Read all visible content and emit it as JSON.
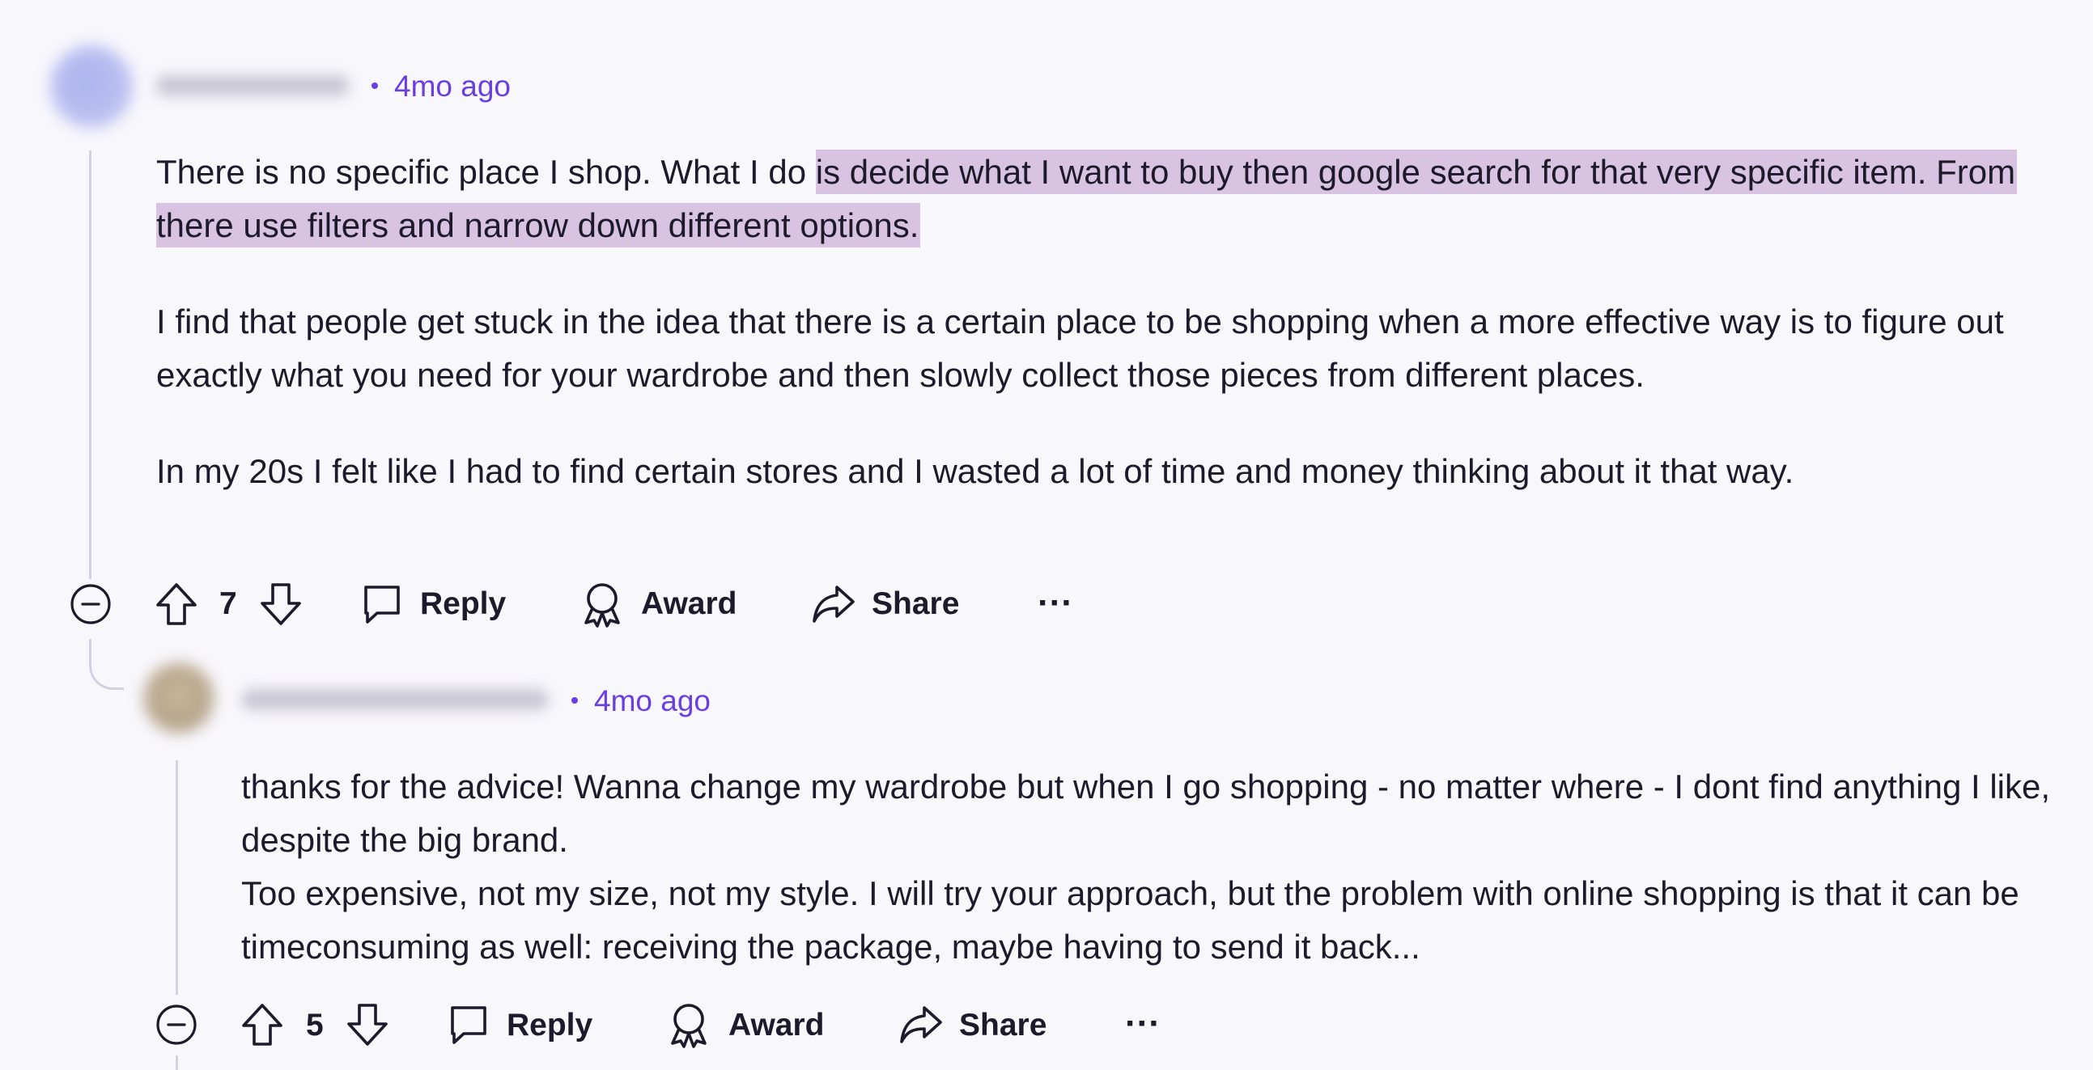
{
  "comments": [
    {
      "time": "4mo ago",
      "body_lines": {
        "p1_plain": "There is no specific place I shop. What I do ",
        "p1_highlight": "is decide what I want to buy then google search for that very specific item. From there use filters and narrow down different options.",
        "p2": "I find that people get stuck in the idea that there is a certain place to be shopping when a more effective way is to figure out exactly what you need for your wardrobe and then slowly collect those pieces from different places.",
        "p3": "In my 20s I felt like I had to find certain stores and I wasted a lot of time and money thinking about it that way."
      },
      "actions": {
        "votes": "7",
        "reply": "Reply",
        "award": "Award",
        "share": "Share",
        "more": "···"
      }
    },
    {
      "time": "4mo ago",
      "body_lines": {
        "p1": "thanks for the advice! Wanna change my wardrobe but when I go shopping - no matter where - I dont find anything I like, despite the big brand.",
        "p2": "Too expensive, not my size, not my style. I will try your approach, but the problem with online shopping is that it can be timeconsuming as well: receiving the package, maybe having to send it back..."
      },
      "actions": {
        "votes": "5",
        "reply": "Reply",
        "award": "Award",
        "share": "Share",
        "more": "···"
      }
    }
  ],
  "colors": {
    "accent": "#6a3fe0",
    "highlight": "#d8c4e2",
    "background": "#f8f7fc"
  }
}
